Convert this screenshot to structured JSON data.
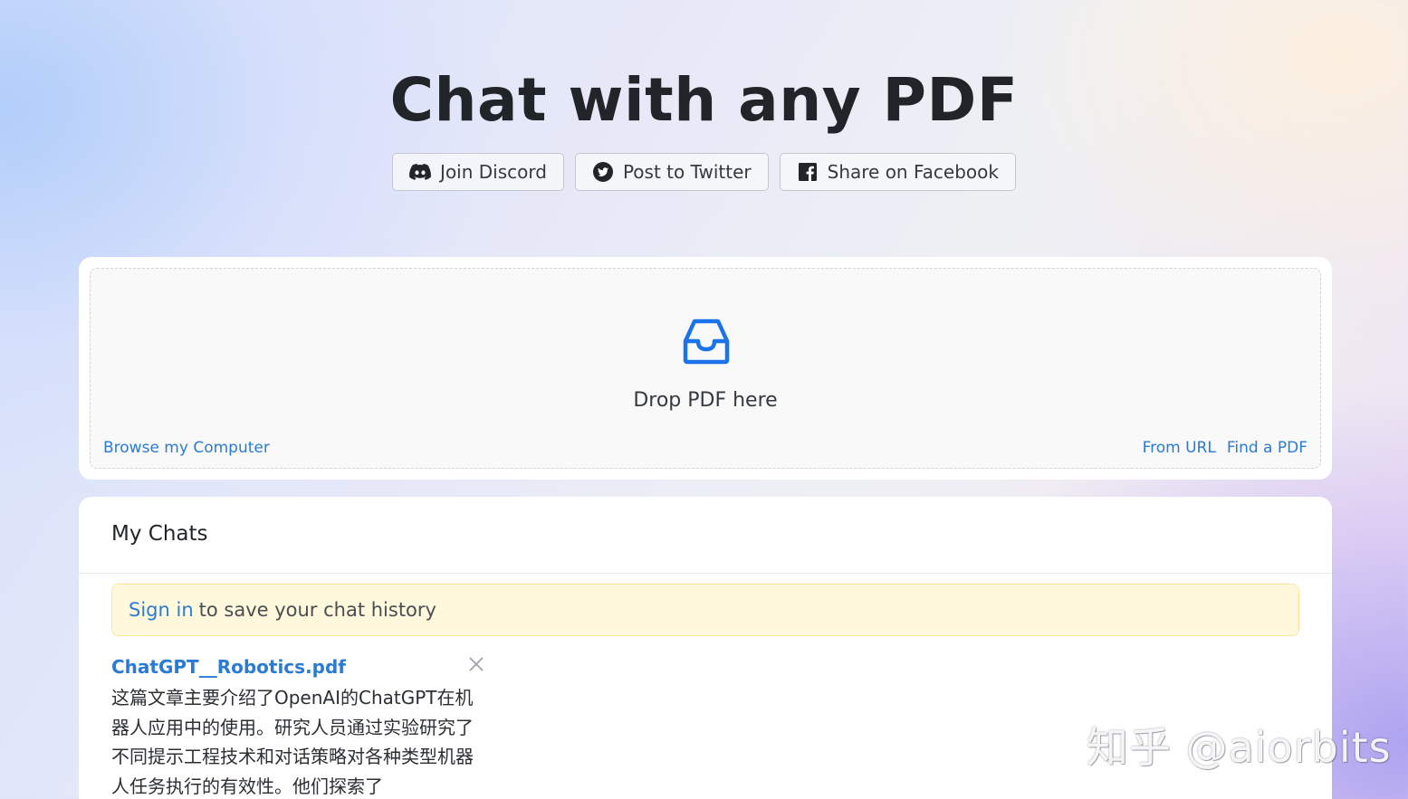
{
  "header": {
    "title": "Chat with any PDF"
  },
  "social": {
    "discord": "Join Discord",
    "twitter": "Post to Twitter",
    "facebook": "Share on Facebook"
  },
  "upload": {
    "drop_text": "Drop PDF here",
    "browse": "Browse my Computer",
    "from_url": "From URL",
    "find_pdf": "Find a PDF",
    "icon": "inbox-icon"
  },
  "chats": {
    "title": "My Chats",
    "notice_link": "Sign in",
    "notice_text": "to save your chat history",
    "items": [
      {
        "file": "ChatGPT__Robotics.pdf",
        "summary": "这篇文章主要介绍了OpenAI的ChatGPT在机器人应用中的使用。研究人员通过实验研究了不同提示工程技术和对话策略对各种类型机器人任务执行的有效性。他们探索了"
      }
    ]
  },
  "watermark": "知乎 @aiorbits",
  "colors": {
    "accent": "#2a7bd4",
    "notice_bg": "#fff8dc",
    "notice_border": "#ffe69c"
  }
}
